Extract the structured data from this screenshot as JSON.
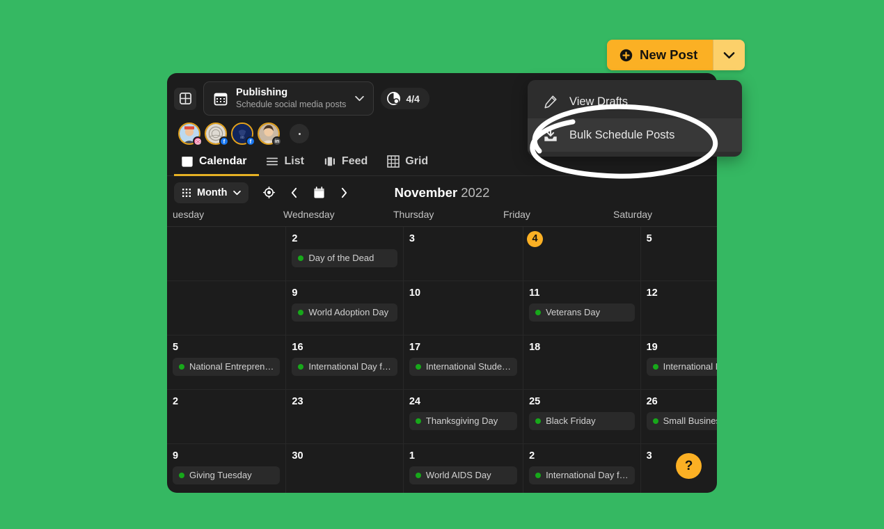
{
  "page": {
    "background_color": "#35b862",
    "card_background": "#1c1c1c",
    "accent_color": "#fbb024",
    "event_dot_color": "#17a81a"
  },
  "new_post": {
    "label": "New Post",
    "icon": "plus-circle-icon",
    "caret_icon": "chevron-down-icon",
    "button_color": "#fbb024",
    "caret_color": "#fcd06a"
  },
  "post_menu": {
    "items": [
      {
        "label": "View Drafts",
        "icon": "pencil-icon",
        "hovered": false
      },
      {
        "label": "Bulk Schedule Posts",
        "icon": "download-inbox-icon",
        "hovered": true
      }
    ]
  },
  "top_bar": {
    "apps_icon": "grid-apps-icon",
    "workspace": {
      "icon": "calendar-icon",
      "title": "Publishing",
      "subtitle": "Schedule social media posts",
      "caret_icon": "chevron-down-icon"
    },
    "accounts_pill": {
      "icon": "accounts-circle-icon",
      "label": "4/4"
    }
  },
  "avatars": [
    {
      "name": "account-avatar-1",
      "network": "instagram",
      "badge": "ig",
      "badge_glyph": "◎"
    },
    {
      "name": "account-avatar-2",
      "network": "facebook",
      "badge": "fb",
      "badge_glyph": "f"
    },
    {
      "name": "account-avatar-3",
      "network": "facebook",
      "badge": "fb",
      "badge_glyph": "f"
    },
    {
      "name": "account-avatar-4",
      "network": "linkedin",
      "badge": "li",
      "badge_glyph": "in"
    }
  ],
  "avatar_more_icon": "more-vertical-icon",
  "view_tabs": [
    {
      "label": "Calendar",
      "icon": "calendar-icon",
      "active": true
    },
    {
      "label": "List",
      "icon": "list-icon",
      "active": false
    },
    {
      "label": "Feed",
      "icon": "feed-icon",
      "active": false
    },
    {
      "label": "Grid",
      "icon": "grid-icon",
      "active": false
    }
  ],
  "calendar_toolbar": {
    "range_label": "Month",
    "range_icon": "dots-grid-icon",
    "range_caret": "chevron-down-icon",
    "today_icon": "target-locate-icon",
    "prev_icon": "chevron-left-icon",
    "calendar_icon": "calendar-icon",
    "next_icon": "chevron-right-icon",
    "month_name": "November",
    "year": "2022"
  },
  "weekdays": [
    "uesday",
    "Wednesday",
    "Thursday",
    "Friday",
    "Saturday"
  ],
  "calendar_cells": [
    {
      "day": "",
      "today": false,
      "events": []
    },
    {
      "day": "2",
      "today": false,
      "events": [
        "Day of the Dead"
      ]
    },
    {
      "day": "3",
      "today": false,
      "events": []
    },
    {
      "day": "4",
      "today": true,
      "events": []
    },
    {
      "day": "5",
      "today": false,
      "events": []
    },
    {
      "day": "",
      "today": false,
      "events": []
    },
    {
      "day": "9",
      "today": false,
      "events": [
        "World Adoption Day"
      ]
    },
    {
      "day": "10",
      "today": false,
      "events": []
    },
    {
      "day": "11",
      "today": false,
      "events": [
        "Veterans Day"
      ]
    },
    {
      "day": "12",
      "today": false,
      "events": []
    },
    {
      "day": "5",
      "today": false,
      "events": [
        "National Entrepren…"
      ]
    },
    {
      "day": "16",
      "today": false,
      "events": [
        "International Day f…"
      ]
    },
    {
      "day": "17",
      "today": false,
      "events": [
        "International Stude…"
      ]
    },
    {
      "day": "18",
      "today": false,
      "events": []
    },
    {
      "day": "19",
      "today": false,
      "events": [
        "International Men's…"
      ]
    },
    {
      "day": "2",
      "today": false,
      "events": []
    },
    {
      "day": "23",
      "today": false,
      "events": []
    },
    {
      "day": "24",
      "today": false,
      "events": [
        "Thanksgiving Day"
      ]
    },
    {
      "day": "25",
      "today": false,
      "events": [
        "Black Friday"
      ]
    },
    {
      "day": "26",
      "today": false,
      "events": [
        "Small Business Sat…"
      ]
    },
    {
      "day": "9",
      "today": false,
      "events": [
        "Giving Tuesday"
      ]
    },
    {
      "day": "30",
      "today": false,
      "events": []
    },
    {
      "day": "1",
      "today": false,
      "events": [
        "World AIDS Day"
      ]
    },
    {
      "day": "2",
      "today": false,
      "events": [
        "International Day f…"
      ]
    },
    {
      "day": "3",
      "today": false,
      "events": []
    }
  ],
  "help_button": {
    "label": "?",
    "icon": "question-mark-icon"
  },
  "annotation": {
    "type": "hand-drawn-ellipse",
    "color": "#ffffff",
    "targets": "Bulk Schedule Posts"
  }
}
